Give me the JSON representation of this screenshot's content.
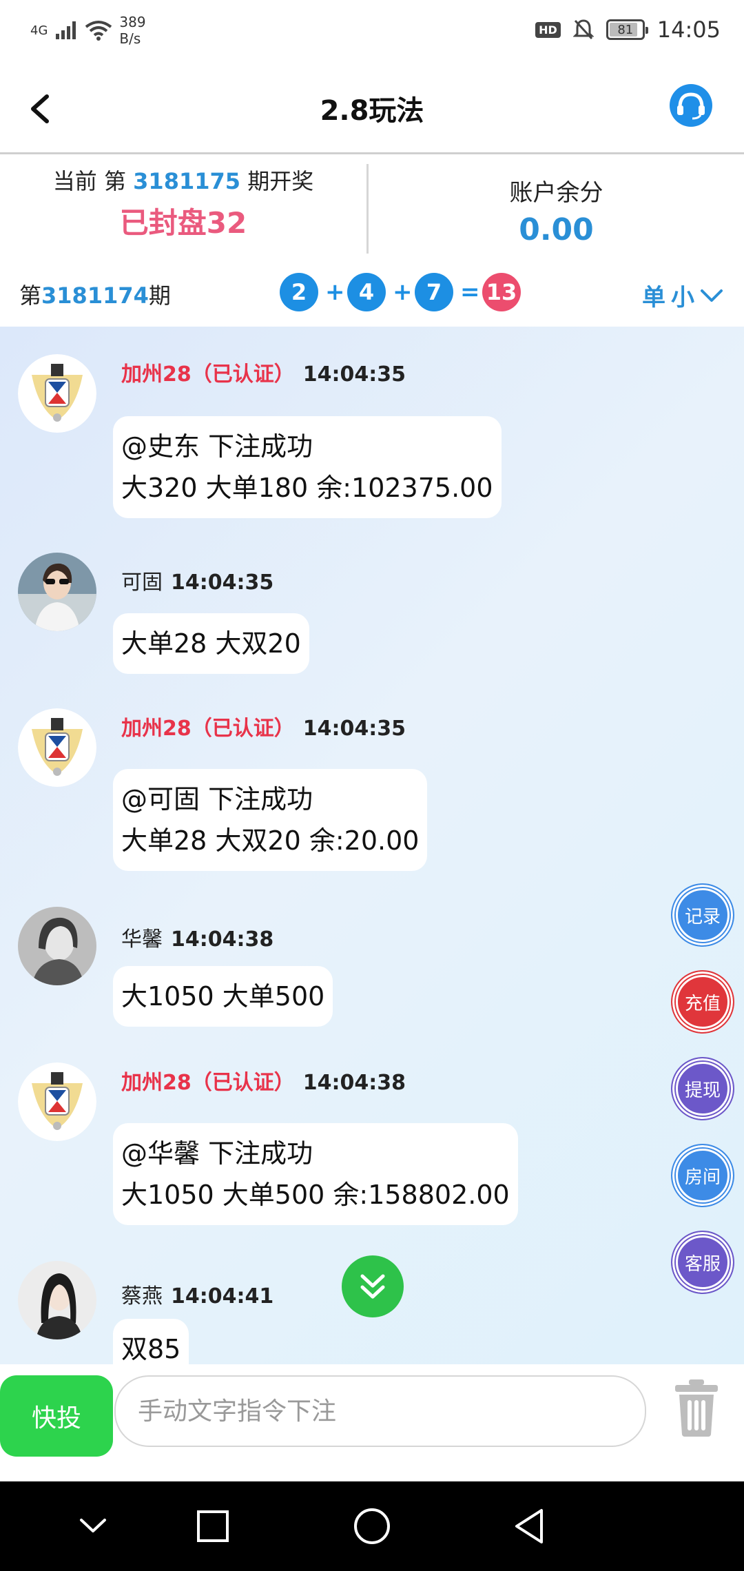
{
  "status_bar": {
    "network": "4G",
    "speed_value": "389",
    "speed_unit": "B/s",
    "hd": "HD",
    "battery": "81",
    "battery_level": 0.81,
    "time": "14:05"
  },
  "header": {
    "title": "2.8玩法"
  },
  "current": {
    "prefix": "当前 第 ",
    "issue": "3181175",
    "suffix": " 期开奖",
    "status": "已封盘32"
  },
  "balance": {
    "label": "账户余分",
    "value": "0.00"
  },
  "last_draw": {
    "prefix": "第",
    "issue": "3181174",
    "suffix": "期",
    "numbers": [
      "2",
      "4",
      "7"
    ],
    "plus": "+",
    "equals": "=",
    "sum": "13",
    "tag1": "单",
    "tag2": "小"
  },
  "messages": [
    {
      "name": "加州28（已认证）",
      "time": "14:04:35",
      "line1": "@史东  下注成功",
      "line2": "大320  大单180 余:102375.00"
    },
    {
      "name": "可固",
      "time": "14:04:35",
      "line1": "大单28  大双20"
    },
    {
      "name": "加州28（已认证）",
      "time": "14:04:35",
      "line1": "@可固  下注成功",
      "line2": "大单28  大双20  余:20.00"
    },
    {
      "name": "华馨",
      "time": "14:04:38",
      "line1": "大1050  大单500"
    },
    {
      "name": "加州28（已认证）",
      "time": "14:04:38",
      "line1": "@华馨  下注成功",
      "line2": "大1050  大单500 余:158802.00"
    },
    {
      "name": "蔡燕",
      "time": "14:04:41",
      "line1": "双85"
    }
  ],
  "side_buttons": [
    "记录",
    "充值",
    "提现",
    "房间",
    "客服"
  ],
  "side_colors": [
    "#3d8be6",
    "#e0363b",
    "#6c58c9",
    "#3d8be6",
    "#6c58c9"
  ],
  "input": {
    "quick_label": "快投",
    "placeholder": "手动文字指令下注"
  }
}
